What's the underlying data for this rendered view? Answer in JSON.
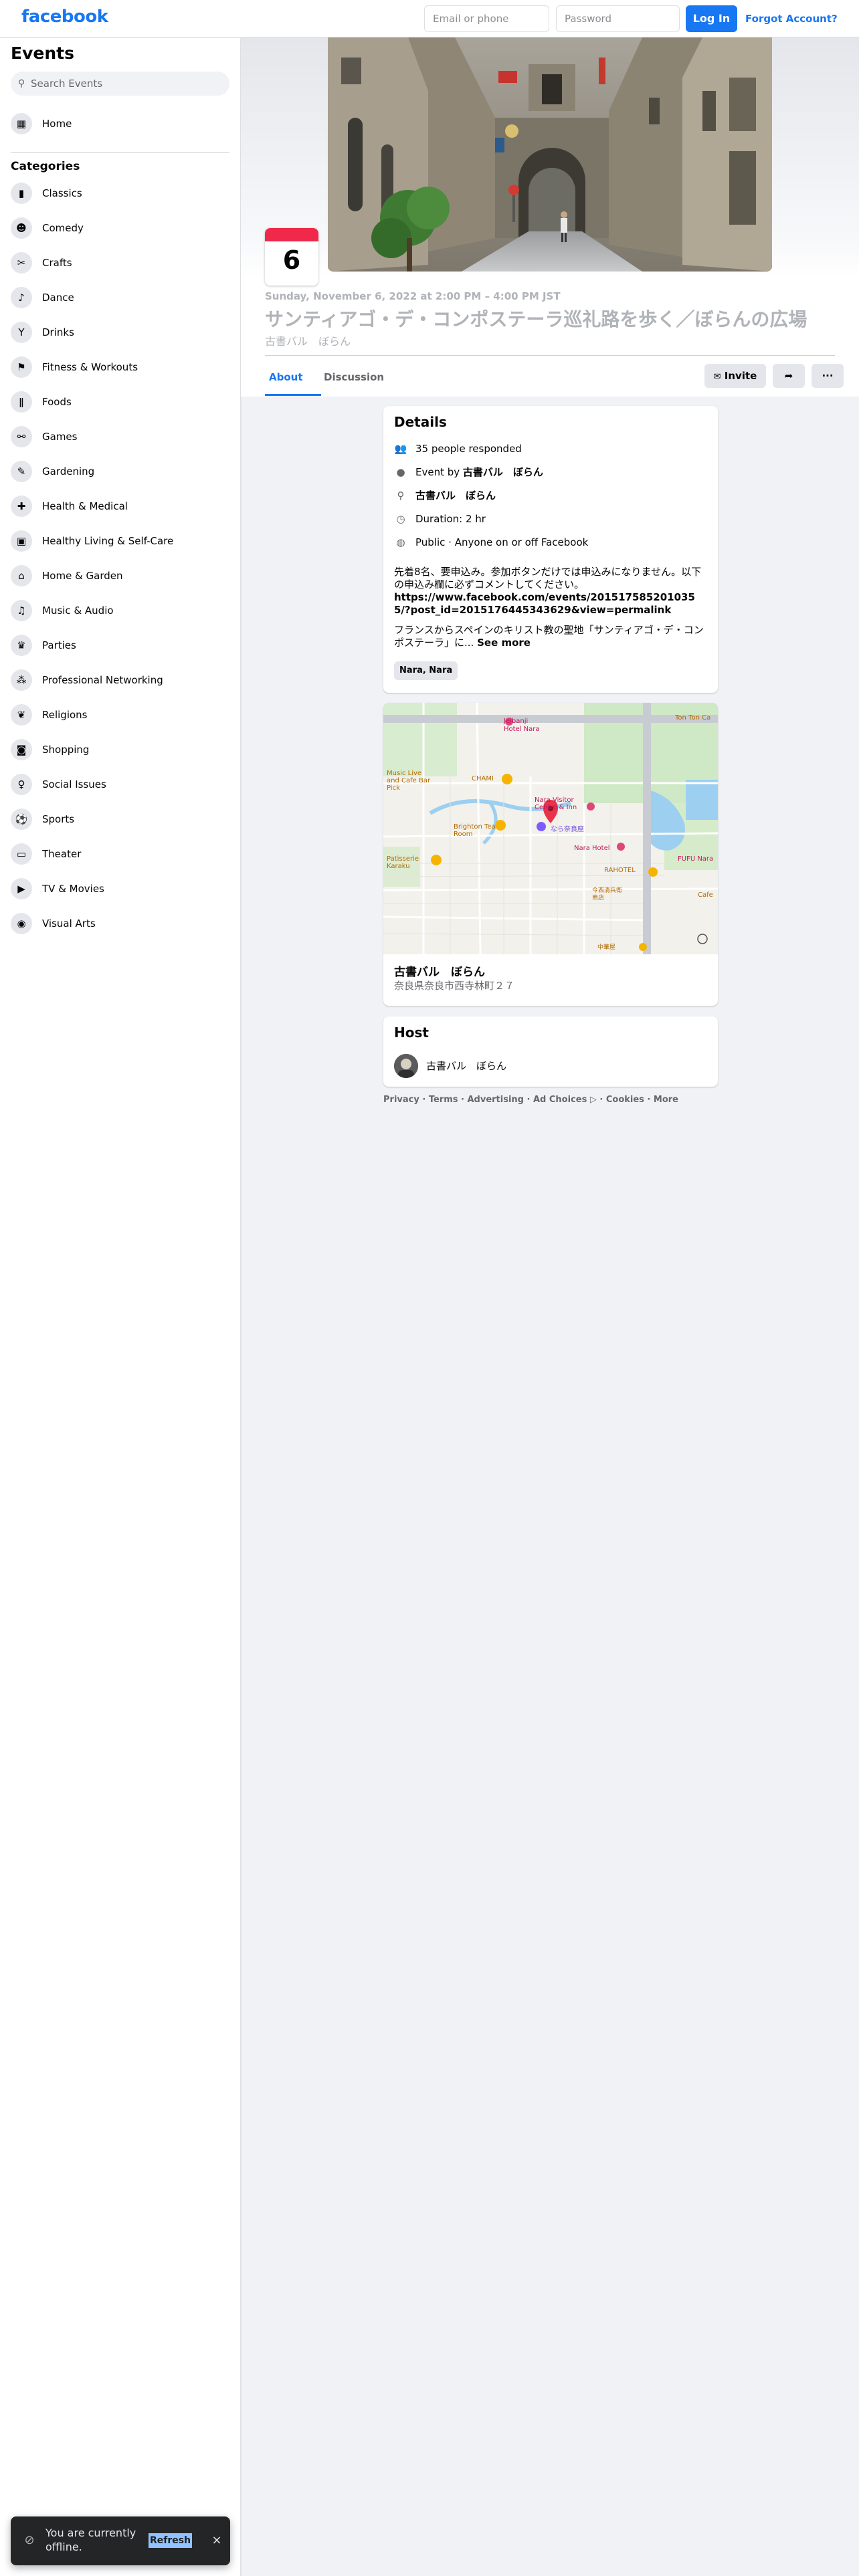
{
  "topbar": {
    "logo": "facebook",
    "email_placeholder": "Email or phone",
    "password_placeholder": "Password",
    "login_label": "Log In",
    "forgot_label": "Forgot Account?"
  },
  "sidebar": {
    "title": "Events",
    "search_placeholder": "Search Events",
    "home_label": "Home",
    "categories_title": "Categories",
    "categories": [
      {
        "label": "Classics",
        "icon": "classics-icon",
        "glyph": "▮"
      },
      {
        "label": "Comedy",
        "icon": "comedy-icon",
        "glyph": "☻"
      },
      {
        "label": "Crafts",
        "icon": "crafts-icon",
        "glyph": "✂"
      },
      {
        "label": "Dance",
        "icon": "dance-icon",
        "glyph": "♪"
      },
      {
        "label": "Drinks",
        "icon": "drinks-icon",
        "glyph": "Y"
      },
      {
        "label": "Fitness & Workouts",
        "icon": "fitness-icon",
        "glyph": "⚑"
      },
      {
        "label": "Foods",
        "icon": "foods-icon",
        "glyph": "ǁ"
      },
      {
        "label": "Games",
        "icon": "games-icon",
        "glyph": "⚯"
      },
      {
        "label": "Gardening",
        "icon": "gardening-icon",
        "glyph": "✎"
      },
      {
        "label": "Health & Medical",
        "icon": "health-icon",
        "glyph": "✚"
      },
      {
        "label": "Healthy Living & Self-Care",
        "icon": "healthy-living-icon",
        "glyph": "▣"
      },
      {
        "label": "Home & Garden",
        "icon": "home-garden-icon",
        "glyph": "⌂"
      },
      {
        "label": "Music & Audio",
        "icon": "music-icon",
        "glyph": "♫"
      },
      {
        "label": "Parties",
        "icon": "parties-icon",
        "glyph": "♛"
      },
      {
        "label": "Professional Networking",
        "icon": "networking-icon",
        "glyph": "⁂"
      },
      {
        "label": "Religions",
        "icon": "religions-icon",
        "glyph": "❦"
      },
      {
        "label": "Shopping",
        "icon": "shopping-icon",
        "glyph": "◙"
      },
      {
        "label": "Social Issues",
        "icon": "social-issues-icon",
        "glyph": "♀"
      },
      {
        "label": "Sports",
        "icon": "sports-icon",
        "glyph": "⚽"
      },
      {
        "label": "Theater",
        "icon": "theater-icon",
        "glyph": "▭"
      },
      {
        "label": "TV & Movies",
        "icon": "tv-movies-icon",
        "glyph": "▶"
      },
      {
        "label": "Visual Arts",
        "icon": "visual-arts-icon",
        "glyph": "◉"
      }
    ]
  },
  "event": {
    "day": "6",
    "date_line": "Sunday, November 6, 2022 at 2:00 PM – 4:00 PM JST",
    "title": "サンティアゴ・デ・コンポステーラ巡礼路を歩く／ぼらんの広場",
    "host_line": "古書バル　ぼらん",
    "tabs": {
      "about": "About",
      "discussion": "Discussion"
    },
    "invite_label": "Invite",
    "more_label": "···"
  },
  "details": {
    "heading": "Details",
    "responded": "35 people responded",
    "event_by_prefix": "Event by ",
    "event_by_name": "古書バル　ぼらん",
    "location": "古書バル　ぼらん",
    "duration": "Duration: 2 hr",
    "privacy": "Public · Anyone on or off Facebook",
    "desc_1": "先着8名、要申込み。参加ボタンだけでは申込みになりません。以下の申込み欄に必ずコメントしてください。",
    "desc_link": "https://www.facebook.com/events/2015175852010355/?post_id=2015176445343629&view=permalink",
    "desc_2": "フランスからスペインのキリスト教の聖地「サンティアゴ・デ・コンポステーラ」に...",
    "see_more": "See more",
    "chip": "Nara, Nara"
  },
  "map_card": {
    "labels": {
      "hotel": "Hotel Nara",
      "hotel_jp": "Jeibanji",
      "tontoncafe": "Ton Ton Ca",
      "chami": "CHAMI",
      "music_live": "Music Live and Cafe Bar Pick",
      "nara_visitor": "Nara Visitor Centre & Inn",
      "naraya": "なら奈良座",
      "brighton": "Brighton Tea Room",
      "nara_hotel": "Nara Hotel",
      "fufu": "FUFU Nara",
      "patisserie": "Patisserie Karaku",
      "rakuto": "RAHOTEL",
      "jp_1": "今西清兵衛商店",
      "jp_2": "中華屋",
      "cafe": "Cafe"
    },
    "place_name": "古書バル　ぼらん",
    "address": "奈良県奈良市西寺林町２７"
  },
  "host_card": {
    "heading": "Host",
    "name": "古書バル　ぼらん"
  },
  "footer": {
    "items": [
      "Privacy",
      "Terms",
      "Advertising",
      "Ad Choices ▷",
      "Cookies",
      "More"
    ],
    "separator": " · "
  },
  "toast": {
    "text": "You are currently offline.",
    "refresh": "Refresh",
    "close": "×"
  },
  "colors": {
    "brand": "#1877f2",
    "calendar_red": "#f02849"
  }
}
